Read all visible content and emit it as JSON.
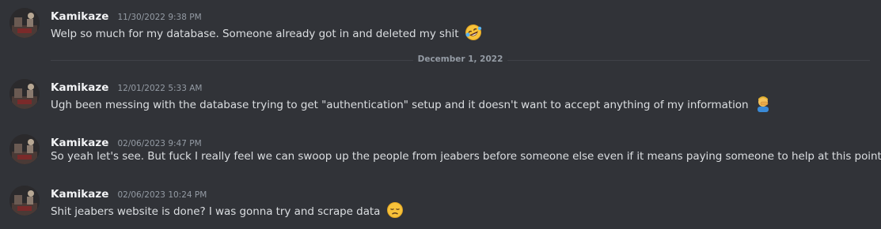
{
  "colors": {
    "background": "#313338",
    "author": "#f2f3f5",
    "text": "#dbdee1",
    "timestamp": "#949ba4",
    "divider": "#3f4147"
  },
  "date_divider": {
    "label": "December 1, 2022"
  },
  "messages": [
    {
      "author": "Kamikaze",
      "timestamp": "11/30/2022 9:38 PM",
      "text": "Welp so much for my database. Someone already got in and deleted my shit",
      "emoji": "rolling-on-floor-laughing"
    },
    {
      "author": "Kamikaze",
      "timestamp": "12/01/2022 5:33 AM",
      "text": "Ugh been messing with the database trying to get \"authentication\" setup and it doesn't want to accept anything of my information",
      "emoji": "man-facepalming"
    },
    {
      "author": "Kamikaze",
      "timestamp": "02/06/2023 9:47 PM",
      "text": "So yeah let's see. But fuck I really feel we can swoop up the people from jeabers before someone else even if it means paying someone to help at this point",
      "emoji": ""
    },
    {
      "author": "Kamikaze",
      "timestamp": "02/06/2023 10:24 PM",
      "text": "Shit jeabers website is done? I was gonna try and scrape data",
      "emoji": "disappointed-face"
    }
  ]
}
